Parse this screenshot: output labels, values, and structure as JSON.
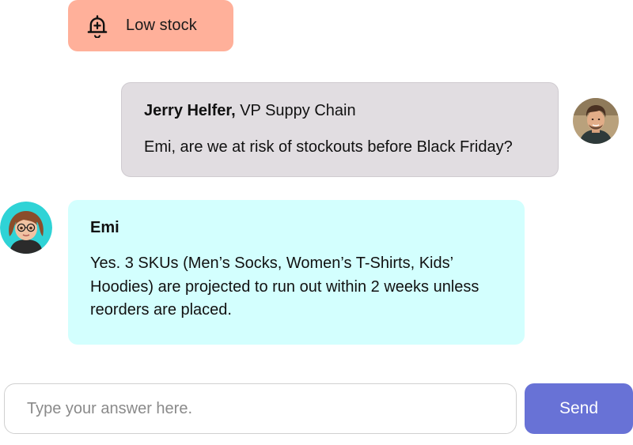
{
  "alert": {
    "label": "Low stock",
    "icon": "bell-plus-icon",
    "color": "#ffb09a"
  },
  "messages": [
    {
      "sender_name": "Jerry Helfer,",
      "sender_title": " VP Suppy Chain",
      "text": "Emi, are we at risk of stockouts before Black Friday?",
      "bubble_color": "#e1dde1",
      "avatar": "user-avatar"
    },
    {
      "sender_name": "Emi",
      "text": "Yes. 3 SKUs (Men’s Socks, Women’s T-Shirts, Kids’ Hoodies) are projected to run out within 2 weeks unless reorders are placed.",
      "bubble_color": "#d3fffe",
      "avatar": "assistant-avatar"
    }
  ],
  "composer": {
    "placeholder": "Type your answer here.",
    "send_label": "Send",
    "send_color": "#6872d6"
  }
}
